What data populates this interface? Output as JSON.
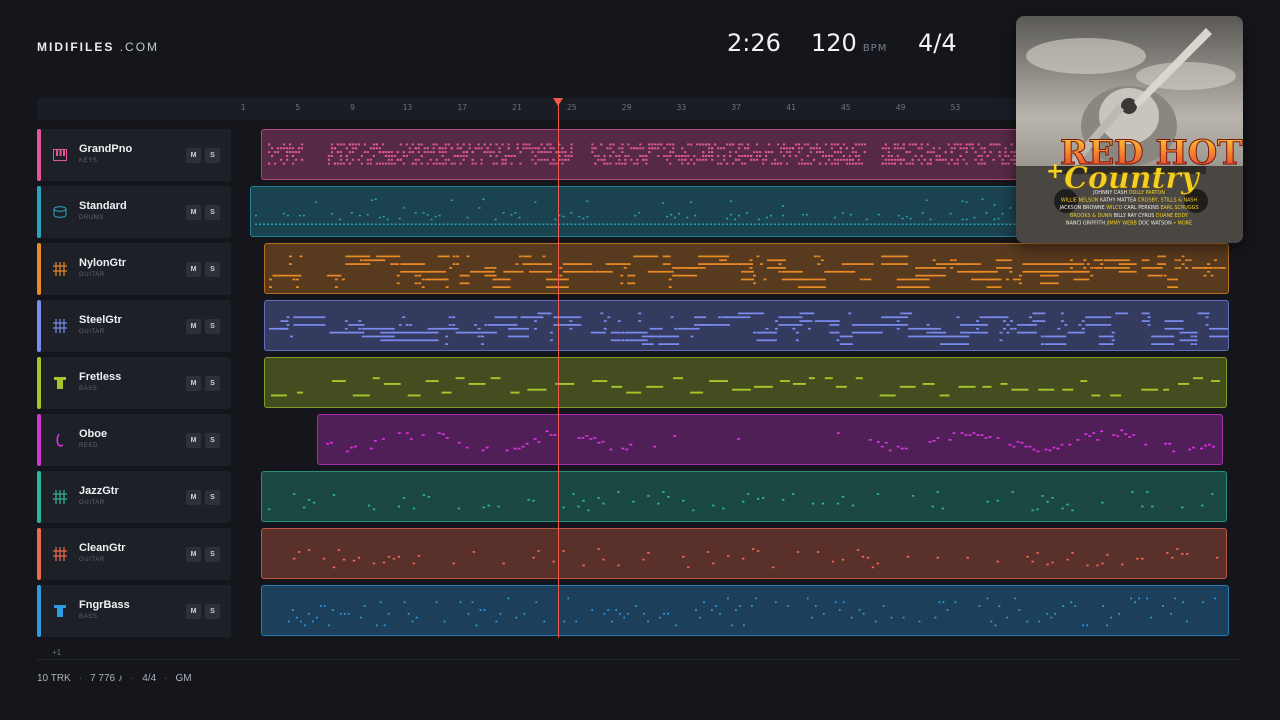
{
  "brand": {
    "name": "MIDIFILES",
    "suffix": ".COM"
  },
  "transport": {
    "time": "2:26",
    "tempo": "120",
    "tempo_unit": "BPM",
    "signature": "4/4"
  },
  "ruler": {
    "ticks": [
      "1",
      "5",
      "9",
      "13",
      "17",
      "21",
      "25",
      "29",
      "33",
      "37",
      "41",
      "45",
      "49",
      "53"
    ]
  },
  "tracks": [
    {
      "name": "GrandPno",
      "category": "KEYS",
      "icon": "piano-keys-icon",
      "color": "#e2579a"
    },
    {
      "name": "Standard",
      "category": "DRUMS",
      "icon": "drum-icon",
      "color": "#2aa3bd"
    },
    {
      "name": "NylonGtr",
      "category": "GUITAR",
      "icon": "guitar-fret-icon",
      "color": "#e98a27"
    },
    {
      "name": "SteelGtr",
      "category": "GUITAR",
      "icon": "guitar-fret-icon",
      "color": "#7a8cf0"
    },
    {
      "name": "Fretless",
      "category": "BASS",
      "icon": "bass-icon",
      "color": "#a8c42a"
    },
    {
      "name": "Oboe",
      "category": "REED",
      "icon": "reed-icon",
      "color": "#d235d9"
    },
    {
      "name": "JazzGtr",
      "category": "GUITAR",
      "icon": "guitar-fret-icon",
      "color": "#2fb59a"
    },
    {
      "name": "CleanGtr",
      "category": "GUITAR",
      "icon": "guitar-fret-icon",
      "color": "#ef6a4f"
    },
    {
      "name": "FngrBass",
      "category": "BASS",
      "icon": "bass-icon",
      "color": "#2e9be3"
    }
  ],
  "mute_label": "M",
  "solo_label": "S",
  "more_tracks": "+1",
  "album": {
    "title_top": "RED HOT",
    "title_bottom": "Country",
    "artists": [
      [
        "JOHNNY CASH",
        "DOLLY PARTON"
      ],
      [
        "WILLIE NELSON",
        "KATHY MATTEA",
        "CROSBY, STILLS & NASH"
      ],
      [
        "JACKSON BROWNE",
        "WILCO",
        "CARL PERKINS",
        "EARL SCRUGGS"
      ],
      [
        "BROOKS & DUNN",
        "BILLY RAY CYRUS",
        "DUANE EDDY"
      ],
      [
        "NANCI GRIFFITH",
        "JIMMY WEBB",
        "DOC WATSON",
        "• MORE"
      ]
    ]
  },
  "footer": {
    "tracks": "10 TRK",
    "notes": "7 776 ♪",
    "signature": "4/4",
    "standard": "GM"
  }
}
